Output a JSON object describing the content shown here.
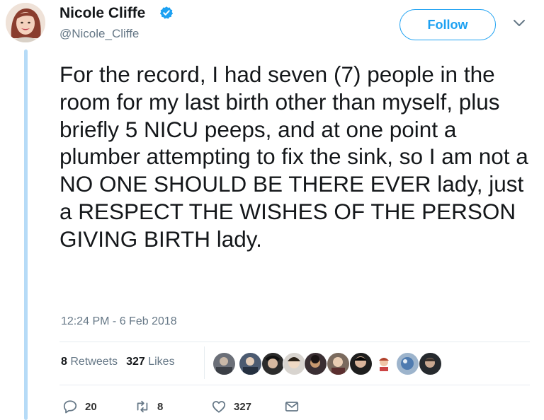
{
  "author": {
    "name": "Nicole Cliffe",
    "handle": "@Nicole_Cliffe",
    "verified": true
  },
  "follow_button": {
    "label": "Follow"
  },
  "tweet": {
    "text": "For the record, I had seven (7) people in the room for my last birth other than myself, plus briefly 5 NICU peeps, and at one point a plumber attempting to fix the sink, so I am not a NO ONE SHOULD BE THERE EVER lady, just a RESPECT THE WISHES OF THE PERSON GIVING BIRTH lady.",
    "timestamp": "12:24 PM - 6 Feb 2018"
  },
  "stats": {
    "retweets_count": "8",
    "retweets_label": "Retweets",
    "likes_count": "327",
    "likes_label": "Likes"
  },
  "actions": {
    "reply_count": "20",
    "retweet_count": "8",
    "like_count": "327"
  },
  "colors": {
    "accent": "#1da1f2",
    "thread_line": "#b6dbf7",
    "text": "#14171a",
    "secondary_text": "#657786"
  },
  "icons": {
    "verified": "verified-badge-icon",
    "chevron": "chevron-down-icon",
    "reply": "reply-icon",
    "retweet": "retweet-icon",
    "like": "heart-icon",
    "dm": "envelope-icon"
  }
}
